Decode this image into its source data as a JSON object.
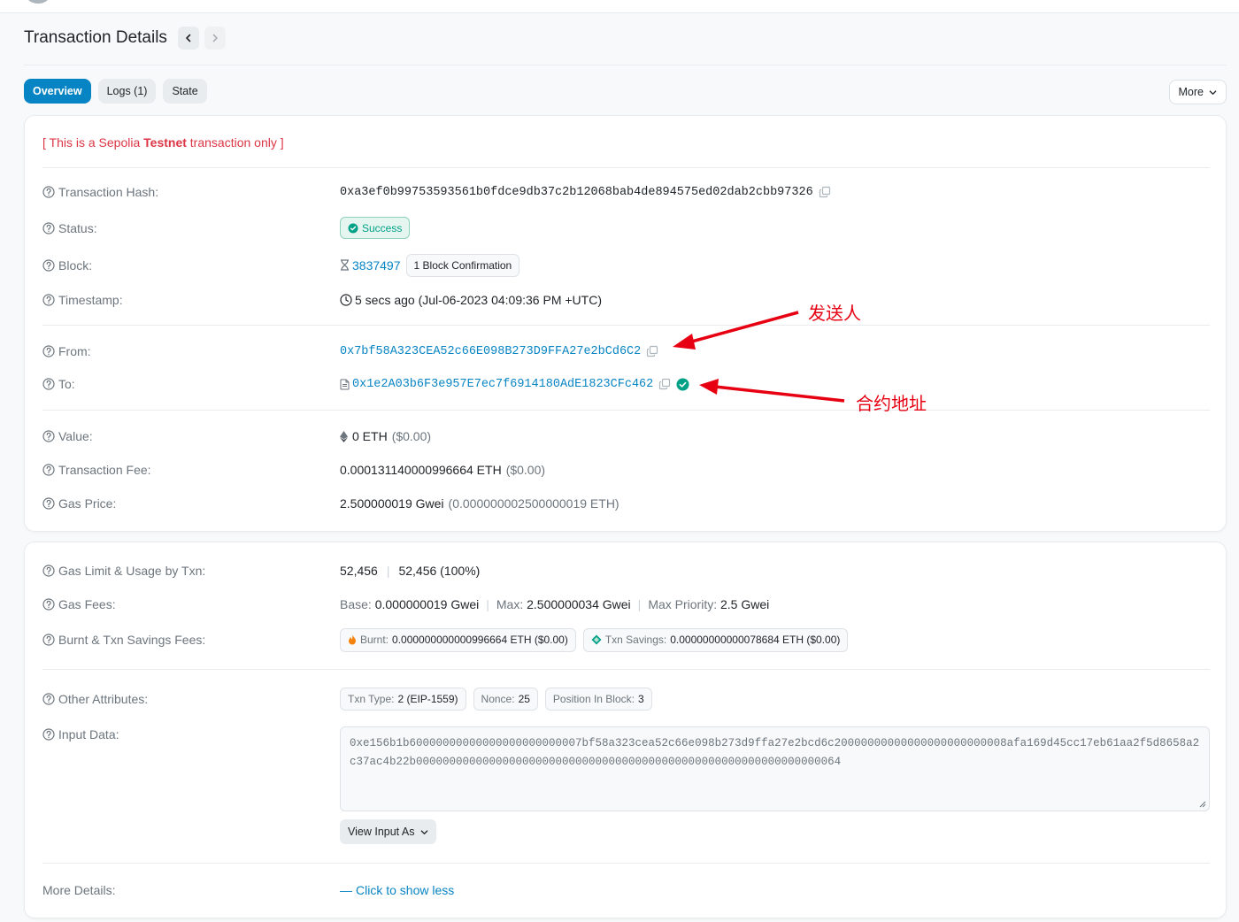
{
  "page": {
    "title": "Transaction Details"
  },
  "tabs": [
    {
      "label": "Overview",
      "active": true
    },
    {
      "label": "Logs (1)",
      "active": false
    },
    {
      "label": "State",
      "active": false
    }
  ],
  "more_button": "More",
  "notice": {
    "prefix": "[ This is a Sepolia ",
    "strong": "Testnet",
    "suffix": " transaction only ]"
  },
  "overview": {
    "hash": {
      "label": "Transaction Hash:",
      "value": "0xa3ef0b99753593561b0fdce9db37c2b12068bab4de894575ed02dab2cbb97326"
    },
    "status": {
      "label": "Status:",
      "value": "Success"
    },
    "block": {
      "label": "Block:",
      "number": "3837497",
      "confirmations": "1 Block Confirmation"
    },
    "timestamp": {
      "label": "Timestamp:",
      "value": "5 secs ago (Jul-06-2023 04:09:36 PM +UTC)"
    },
    "from": {
      "label": "From:",
      "value": "0x7bf58A323CEA52c66E098B273D9FFA27e2bCd6C2"
    },
    "to": {
      "label": "To:",
      "value": "0x1e2A03b6F3e957E7ec7f6914180AdE1823CFc462"
    },
    "value": {
      "label": "Value:",
      "amount": "0 ETH",
      "usd": "($0.00)"
    },
    "fee": {
      "label": "Transaction Fee:",
      "amount": "0.000131140000996664 ETH",
      "usd": "($0.00)"
    },
    "gas_price": {
      "label": "Gas Price:",
      "amount": "2.500000019 Gwei",
      "eth": "(0.000000002500000019 ETH)"
    }
  },
  "gas": {
    "limit": {
      "label": "Gas Limit & Usage by Txn:",
      "limit": "52,456",
      "usage": "52,456 (100%)"
    },
    "fees": {
      "label": "Gas Fees:",
      "base_k": "Base:",
      "base_v": "0.000000019 Gwei",
      "max_k": "Max:",
      "max_v": "2.500000034 Gwei",
      "prio_k": "Max Priority:",
      "prio_v": "2.5 Gwei"
    },
    "burnt": {
      "label": "Burnt & Txn Savings Fees:",
      "burnt_k": "Burnt:",
      "burnt_v": "0.000000000000996664 ETH ($0.00)",
      "savings_k": "Txn Savings:",
      "savings_v": "0.00000000000078684 ETH ($0.00)"
    },
    "attrs": {
      "label": "Other Attributes:",
      "type_k": "Txn Type:",
      "type_v": "2 (EIP-1559)",
      "nonce_k": "Nonce:",
      "nonce_v": "25",
      "pos_k": "Position In Block:",
      "pos_v": "3"
    },
    "input": {
      "label": "Input Data:",
      "value": "0xe156b1b60000000000000000000000007bf58a323cea52c66e098b273d9ffa27e2bcd6c20000000000000000000000008afa169d45cc17eb61aa2f5d8658a2c37ac4b22b0000000000000000000000000000000000000000000000000000000000000064",
      "view_as": "View Input As"
    },
    "more_details": {
      "label": "More Details:",
      "toggle": "Click to show less"
    }
  },
  "annotations": {
    "sender": "发送人",
    "contract": "合约地址"
  },
  "colors": {
    "accent": "#0784c3",
    "success": "#00a186",
    "danger": "#dc3545",
    "annotation": "#e60012"
  }
}
